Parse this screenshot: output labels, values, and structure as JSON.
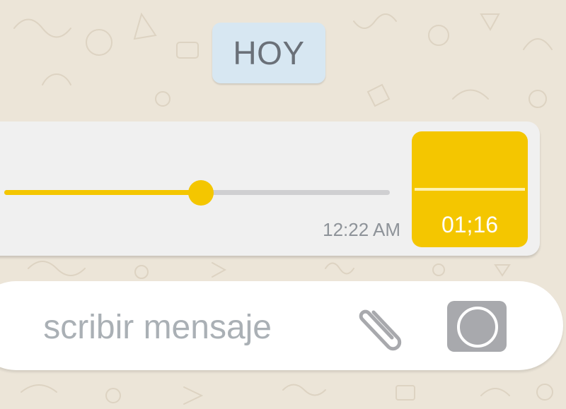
{
  "chat": {
    "date_chip": "HOY"
  },
  "voice_message": {
    "progress": 0.51,
    "timestamp": "12:22 AM",
    "duration": "01;16"
  },
  "composer": {
    "placeholder": "scribir mensaje"
  },
  "colors": {
    "accent": "#f4c600",
    "track": "#cfcfd1",
    "wallpaper": "#ece5d8",
    "date_chip": "#d7e7f2",
    "camera_button": "#a8a9ad"
  },
  "icons": {
    "attach": "paperclip-icon",
    "camera": "camera-icon"
  }
}
